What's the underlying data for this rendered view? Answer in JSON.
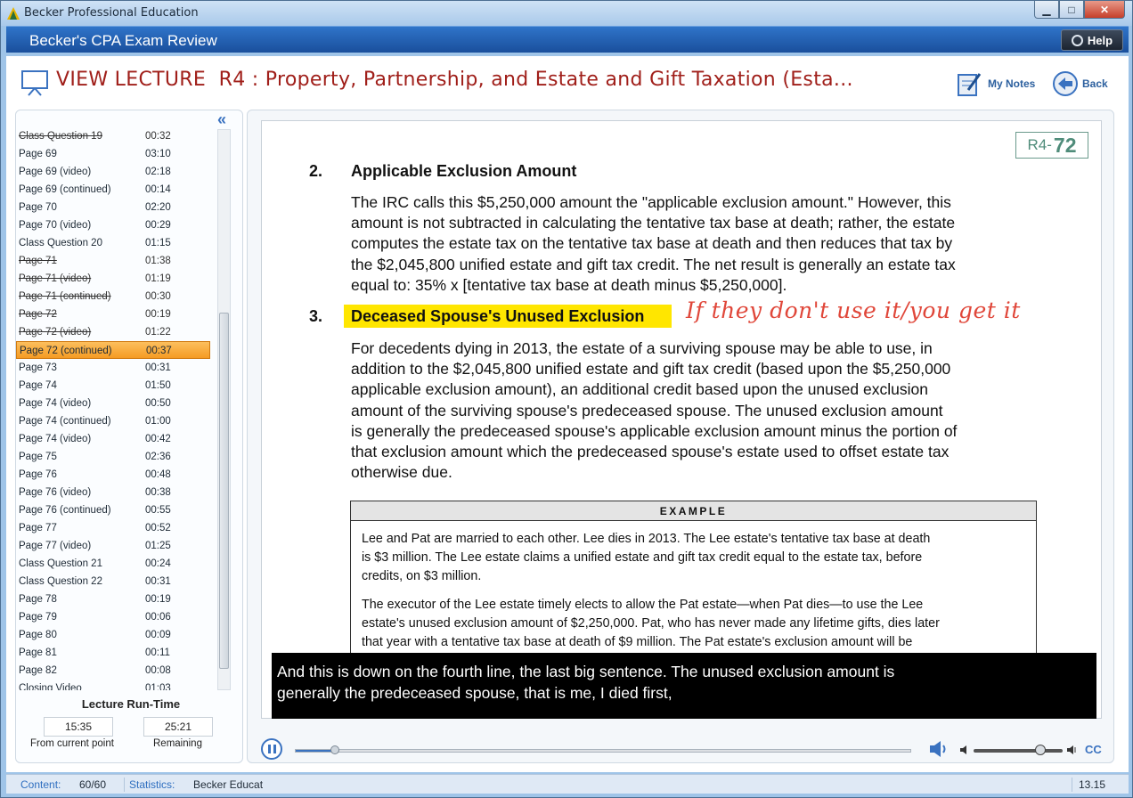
{
  "window": {
    "title": "Becker Professional Education",
    "min_label": "▁",
    "max_label": "□",
    "close_label": "✕"
  },
  "app": {
    "title": "Becker's CPA Exam Review",
    "help_label": "Help"
  },
  "header": {
    "view_label": "VIEW LECTURE",
    "lecture_title": "R4 : Property, Partnership, and Estate and Gift Taxation (Esta...",
    "notes_label": "My Notes",
    "back_label": "Back"
  },
  "playlist": [
    {
      "label": "Class Question 19",
      "time": "00:32",
      "state": "done"
    },
    {
      "label": "Page 69",
      "time": "03:10",
      "state": ""
    },
    {
      "label": "Page 69 (video)",
      "time": "02:18",
      "state": ""
    },
    {
      "label": "Page 69 (continued)",
      "time": "00:14",
      "state": ""
    },
    {
      "label": "Page 70",
      "time": "02:20",
      "state": ""
    },
    {
      "label": "Page 70 (video)",
      "time": "00:29",
      "state": ""
    },
    {
      "label": "Class Question 20",
      "time": "01:15",
      "state": ""
    },
    {
      "label": "Page 71",
      "time": "01:38",
      "state": "done"
    },
    {
      "label": "Page 71 (video)",
      "time": "01:19",
      "state": "done"
    },
    {
      "label": "Page 71 (continued)",
      "time": "00:30",
      "state": "done"
    },
    {
      "label": "Page 72",
      "time": "00:19",
      "state": "done"
    },
    {
      "label": "Page 72 (video)",
      "time": "01:22",
      "state": "done"
    },
    {
      "label": "Page 72 (continued)",
      "time": "00:37",
      "state": "active"
    },
    {
      "label": "Page 73",
      "time": "00:31",
      "state": ""
    },
    {
      "label": "Page 74",
      "time": "01:50",
      "state": ""
    },
    {
      "label": "Page 74 (video)",
      "time": "00:50",
      "state": ""
    },
    {
      "label": "Page 74 (continued)",
      "time": "01:00",
      "state": ""
    },
    {
      "label": "Page 74 (video)",
      "time": "00:42",
      "state": ""
    },
    {
      "label": "Page 75",
      "time": "02:36",
      "state": ""
    },
    {
      "label": "Page 76",
      "time": "00:48",
      "state": ""
    },
    {
      "label": "Page 76 (video)",
      "time": "00:38",
      "state": ""
    },
    {
      "label": "Page 76 (continued)",
      "time": "00:55",
      "state": ""
    },
    {
      "label": "Page 77",
      "time": "00:52",
      "state": ""
    },
    {
      "label": "Page 77 (video)",
      "time": "01:25",
      "state": ""
    },
    {
      "label": "Class Question 21",
      "time": "00:24",
      "state": ""
    },
    {
      "label": "Class Question 22",
      "time": "00:31",
      "state": ""
    },
    {
      "label": "Page 78",
      "time": "00:19",
      "state": ""
    },
    {
      "label": "Page 79",
      "time": "00:06",
      "state": ""
    },
    {
      "label": "Page 80",
      "time": "00:09",
      "state": ""
    },
    {
      "label": "Page 81",
      "time": "00:11",
      "state": ""
    },
    {
      "label": "Page 82",
      "time": "00:08",
      "state": ""
    },
    {
      "label": "Closing Video",
      "time": "01:03",
      "state": ""
    }
  ],
  "runtime": {
    "title": "Lecture Run-Time",
    "current": "15:35",
    "remaining": "25:21",
    "current_caption": "From current point",
    "remaining_caption": "Remaining"
  },
  "slide": {
    "page_prefix": "R4-",
    "page_number": "72",
    "s2_num": "2.",
    "s2_title": "Applicable Exclusion Amount",
    "s2_lines": [
      "The IRC calls this $5,250,000 amount the \"applicable exclusion amount.\"  However, this",
      "amount is not subtracted in calculating the tentative tax base at death; rather, the estate",
      "computes the estate tax on the tentative tax base at death and then reduces that tax by",
      "the $2,045,800 unified estate and gift tax credit.  The net result is generally an estate tax",
      "equal to: 35% x [tentative tax base at death minus $5,250,000]."
    ],
    "s3_num": "3.",
    "s3_title": "Deceased Spouse's Unused Exclusion",
    "handwritten_note": "If they don't use it/you get it",
    "s3_lines": [
      "For decedents dying in 2013, the estate of a surviving spouse may be able to use, in",
      "addition to the $2,045,800 unified estate and gift tax credit (based upon the $5,250,000",
      "applicable exclusion amount), an additional credit based upon the unused exclusion",
      "amount of the surviving spouse's predeceased spouse.  The unused exclusion amount",
      "is generally the predeceased spouse's applicable exclusion amount minus the portion of",
      "that exclusion amount which the predeceased spouse's estate used to offset estate tax",
      "otherwise due."
    ],
    "example_title": "EXAMPLE",
    "example_p1": [
      "Lee and Pat are married to each other.  Lee dies in 2013.  The Lee estate's tentative tax base at death",
      "is $3 million.  The Lee estate claims a unified estate and gift tax credit equal to the estate tax, before",
      "credits, on $3 million."
    ],
    "example_p2": [
      "The executor of the Lee estate timely elects to allow the Pat estate—when Pat dies—to use the Lee",
      "estate's unused exclusion amount of $2,250,000.  Pat, who has never made any lifetime gifts, dies later",
      "that year with a tentative tax base at death of $9 million.  The Pat estate's exclusion amount will be"
    ]
  },
  "caption": {
    "line1": "And this is down on the fourth line, the last big sentence.  The unused exclusion amount is",
    "line2": "generally the predeceased spouse, that is me, I died first,"
  },
  "player": {
    "progress_fraction": 0.064,
    "volume_fraction": 0.75,
    "cc_label": "CC"
  },
  "status": {
    "content_label": "Content:",
    "content_value": "60/60",
    "stats_label": "Statistics:",
    "stats_value": "Becker Educat",
    "version": "13.15"
  },
  "colors": {
    "accent": "#3a72c0",
    "header_red": "#a01f1a",
    "active_row": "#f59b23",
    "highlight": "#ffe600",
    "handwriting": "#e0473a"
  }
}
